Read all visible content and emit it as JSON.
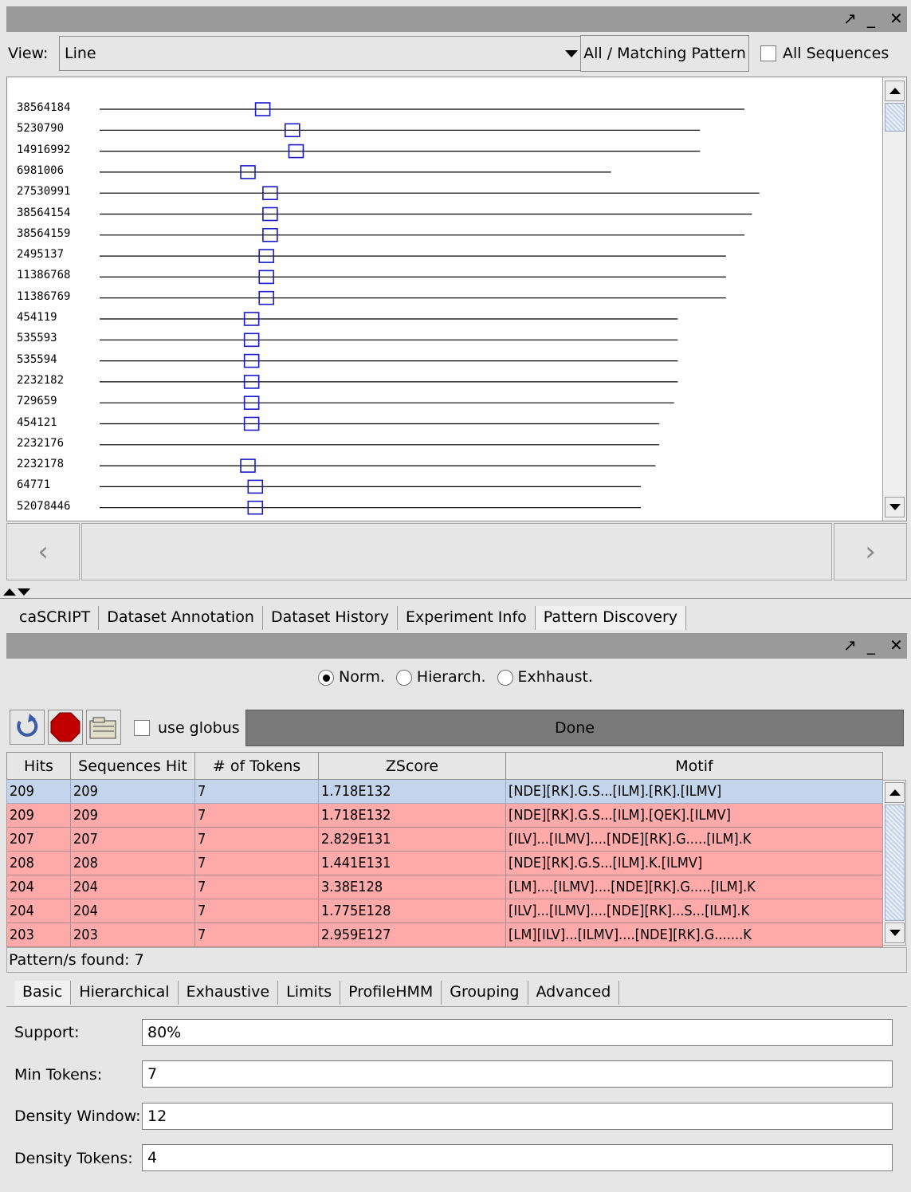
{
  "top_window": {
    "controls": [
      "↗",
      "_",
      "✕"
    ]
  },
  "toolbar": {
    "view_label": "View:",
    "view_value": "Line",
    "pattern_button": "All / Matching Pattern",
    "all_sequences_label": "All Sequences"
  },
  "sequences": [
    {
      "id": "38564184",
      "length": 0.87,
      "motif": 0.22
    },
    {
      "id": "5230790",
      "length": 0.81,
      "motif": 0.26
    },
    {
      "id": "14916992",
      "length": 0.81,
      "motif": 0.265
    },
    {
      "id": "6981006",
      "length": 0.69,
      "motif": 0.2
    },
    {
      "id": "27530991",
      "length": 0.89,
      "motif": 0.23
    },
    {
      "id": "38564154",
      "length": 0.88,
      "motif": 0.23
    },
    {
      "id": "38564159",
      "length": 0.87,
      "motif": 0.23
    },
    {
      "id": "2495137",
      "length": 0.845,
      "motif": 0.225
    },
    {
      "id": "11386768",
      "length": 0.845,
      "motif": 0.225
    },
    {
      "id": "11386769",
      "length": 0.845,
      "motif": 0.225
    },
    {
      "id": "454119",
      "length": 0.78,
      "motif": 0.205
    },
    {
      "id": "535593",
      "length": 0.78,
      "motif": 0.205
    },
    {
      "id": "535594",
      "length": 0.78,
      "motif": 0.205
    },
    {
      "id": "2232182",
      "length": 0.78,
      "motif": 0.205
    },
    {
      "id": "729659",
      "length": 0.775,
      "motif": 0.205
    },
    {
      "id": "454121",
      "length": 0.755,
      "motif": 0.205
    },
    {
      "id": "2232176",
      "length": 0.755,
      "motif": null
    },
    {
      "id": "2232178",
      "length": 0.75,
      "motif": 0.2
    },
    {
      "id": "64771",
      "length": 0.73,
      "motif": 0.21
    },
    {
      "id": "52078446",
      "length": 0.73,
      "motif": 0.21
    }
  ],
  "nav": {
    "prev": "‹",
    "next": "›"
  },
  "tabs": [
    "caSCRIPT",
    "Dataset Annotation",
    "Dataset History",
    "Experiment Info",
    "Pattern Discovery"
  ],
  "active_tab": 4,
  "bottom_window": {
    "controls": [
      "↗",
      "_",
      "✕"
    ]
  },
  "modes": {
    "norm": "Norm.",
    "hierarch": "Hierarch.",
    "exhaust": "Exhhaust."
  },
  "tools": {
    "use_globus": "use globus",
    "status": "Done"
  },
  "table": {
    "columns": [
      "Hits",
      "Sequences Hit",
      "# of Tokens",
      "ZScore",
      "Motif"
    ],
    "rows": [
      [
        "209",
        "209",
        "7",
        "1.718E132",
        "[NDE][RK].G.S...[ILM].[RK].[ILMV]"
      ],
      [
        "209",
        "209",
        "7",
        "1.718E132",
        "[NDE][RK].G.S...[ILM].[QEK].[ILMV]"
      ],
      [
        "207",
        "207",
        "7",
        "2.829E131",
        "[ILV]...[ILMV]....[NDE][RK].G.....[ILM].K"
      ],
      [
        "208",
        "208",
        "7",
        "1.441E131",
        "[NDE][RK].G.S...[ILM].K.[ILMV]"
      ],
      [
        "204",
        "204",
        "7",
        "3.38E128",
        "[LM]....[ILMV]....[NDE][RK].G.....[ILM].K"
      ],
      [
        "204",
        "204",
        "7",
        "1.775E128",
        "[ILV]...[ILMV]....[NDE][RK]...S...[ILM].K"
      ],
      [
        "203",
        "203",
        "7",
        "2.959E127",
        "[LM][ILV]...[ILMV]....[NDE][RK].G.......K"
      ]
    ]
  },
  "status": "Pattern/s found: 7",
  "param_tabs": [
    "Basic",
    "Hierarchical",
    "Exhaustive",
    "Limits",
    "ProfileHMM",
    "Grouping",
    "Advanced"
  ],
  "params": {
    "support_label": "Support:",
    "support": "80%",
    "min_tokens_label": "Min Tokens:",
    "min_tokens": "7",
    "density_window_label": "Density Window:",
    "density_window": "12",
    "density_tokens_label": "Density Tokens:",
    "density_tokens": "4"
  }
}
